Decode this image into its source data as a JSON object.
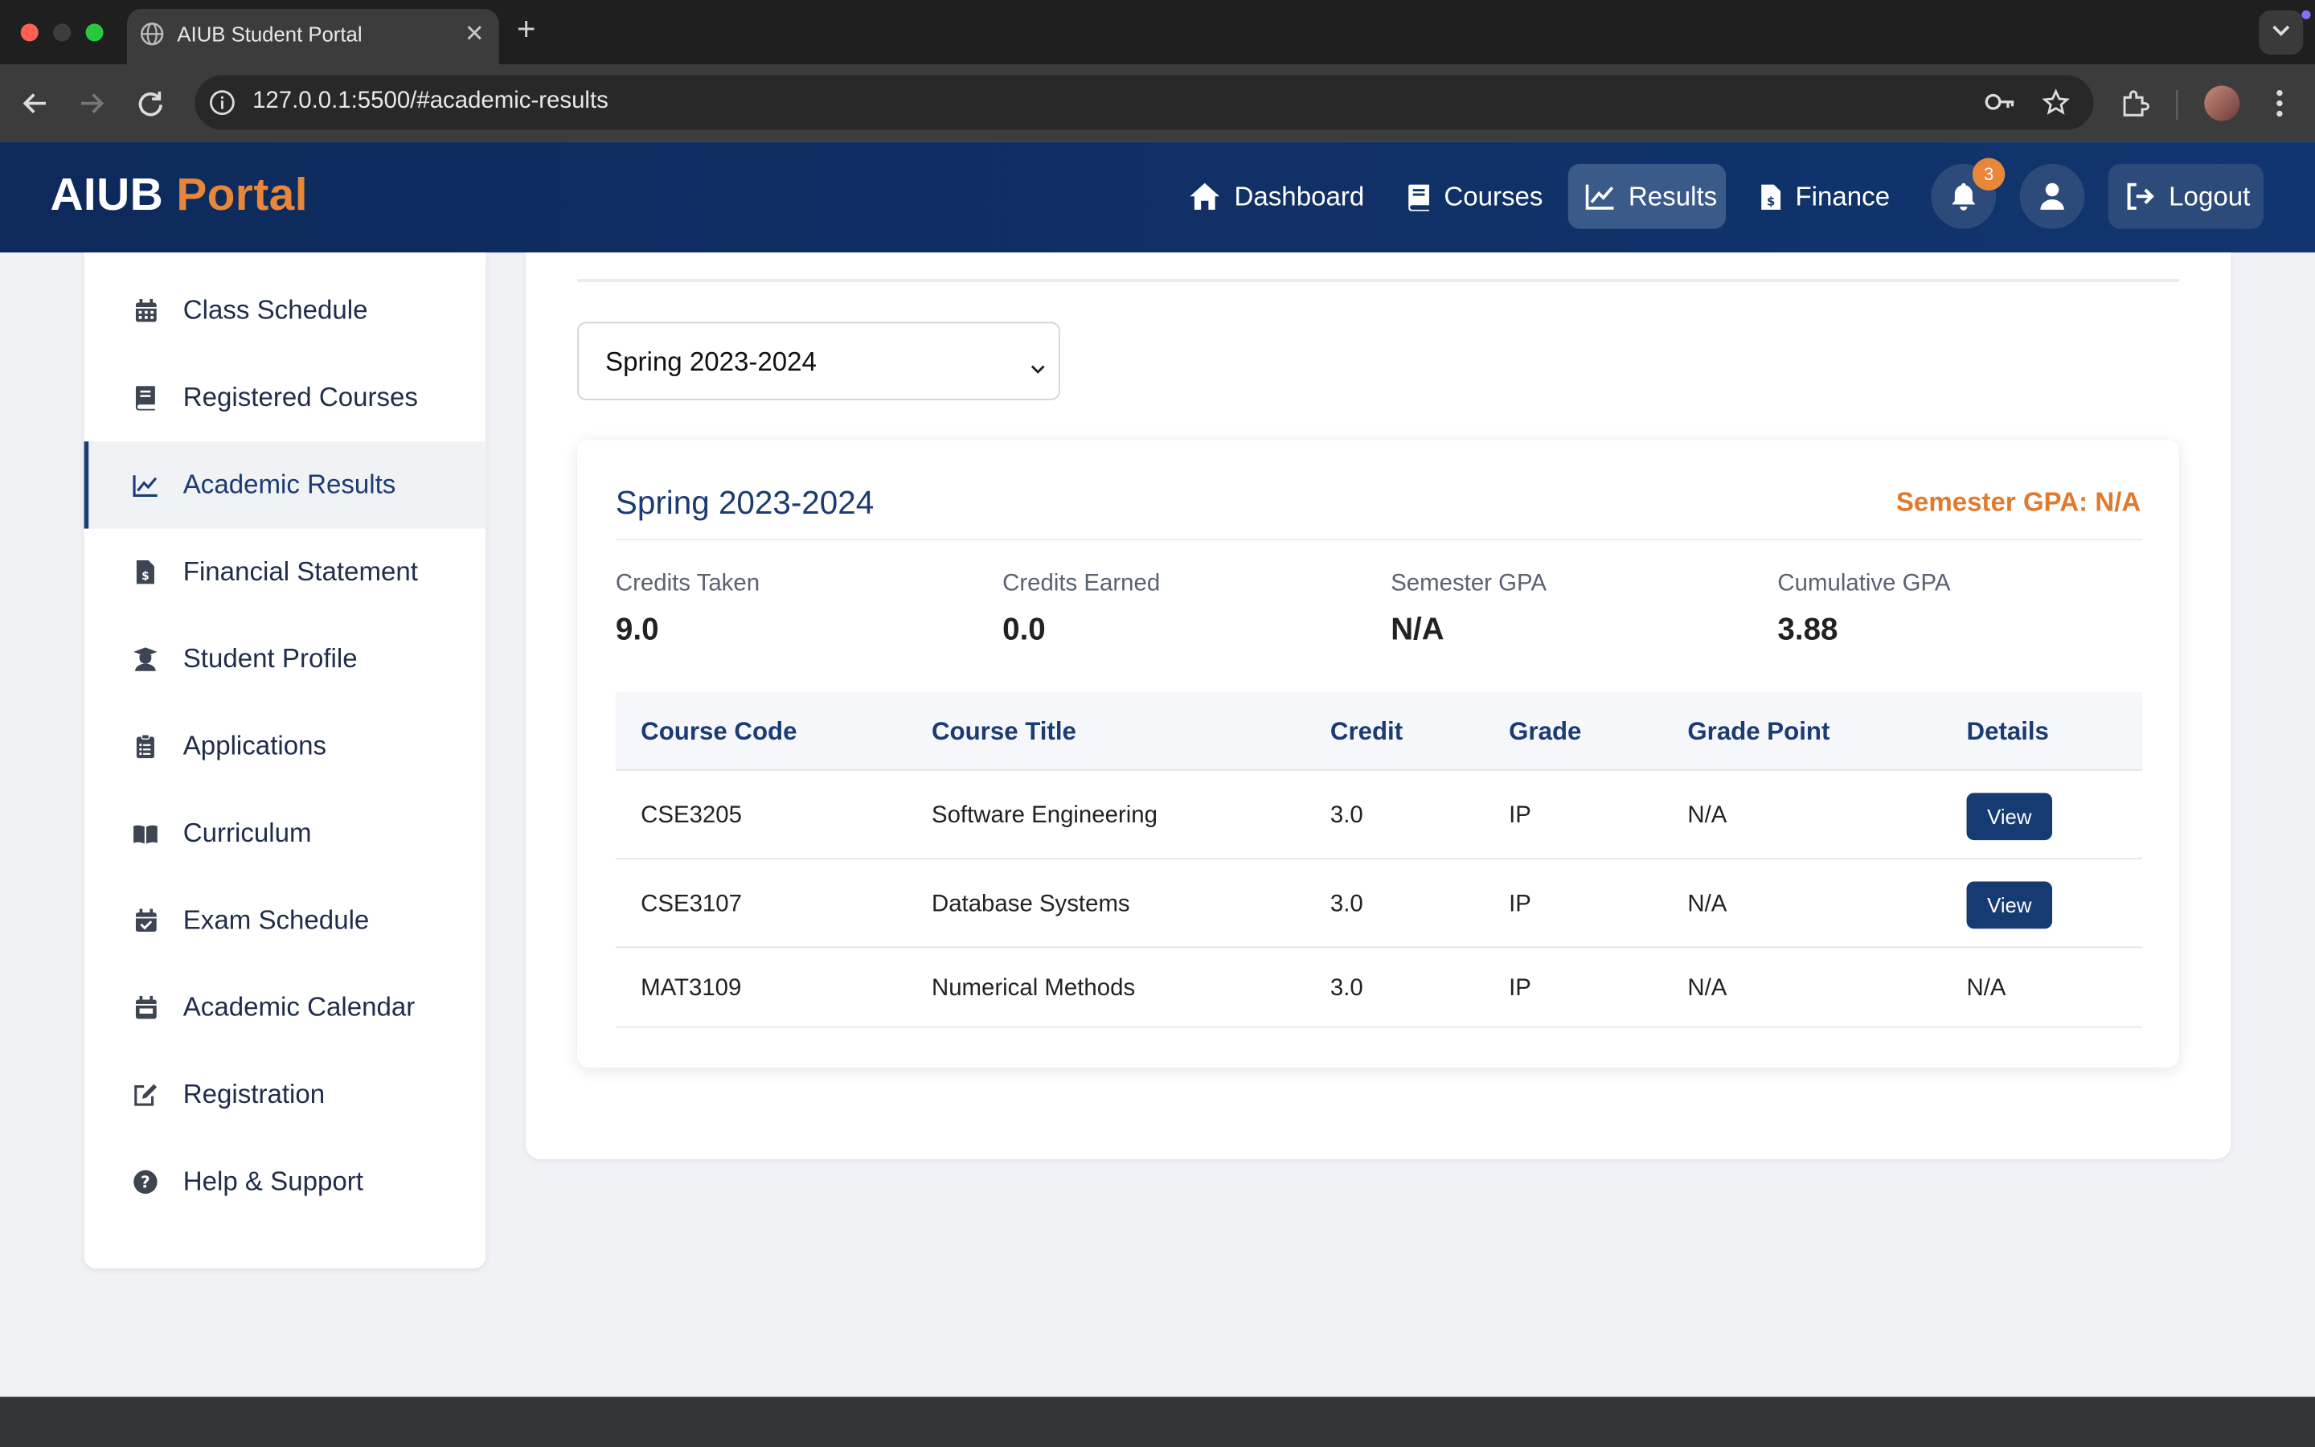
{
  "browser": {
    "tab_title": "AIUB Student Portal",
    "url": "127.0.0.1:5500/#academic-results"
  },
  "header": {
    "logo_main": "AIUB",
    "logo_accent": "Portal",
    "nav": [
      {
        "label": "Dashboard",
        "icon": "home-icon"
      },
      {
        "label": "Courses",
        "icon": "book-icon"
      },
      {
        "label": "Results",
        "icon": "chart-line-icon",
        "active": true
      },
      {
        "label": "Finance",
        "icon": "invoice-icon"
      }
    ],
    "notification_count": "3",
    "logout_label": "Logout"
  },
  "sidebar": {
    "items": [
      {
        "label": "Class Schedule",
        "icon": "calendar-icon"
      },
      {
        "label": "Registered Courses",
        "icon": "book-icon"
      },
      {
        "label": "Academic Results",
        "icon": "chart-line-icon",
        "active": true
      },
      {
        "label": "Financial Statement",
        "icon": "invoice-dollar-icon"
      },
      {
        "label": "Student Profile",
        "icon": "graduate-icon"
      },
      {
        "label": "Applications",
        "icon": "clipboard-icon"
      },
      {
        "label": "Curriculum",
        "icon": "open-book-icon"
      },
      {
        "label": "Exam Schedule",
        "icon": "calendar-check-icon"
      },
      {
        "label": "Academic Calendar",
        "icon": "calendar-day-icon"
      },
      {
        "label": "Registration",
        "icon": "edit-icon"
      },
      {
        "label": "Help & Support",
        "icon": "question-circle-icon"
      }
    ]
  },
  "main": {
    "semester_select": "Spring 2023-2024",
    "card": {
      "title": "Spring 2023-2024",
      "gpa_badge": "Semester GPA: N/A",
      "stats": [
        {
          "label": "Credits Taken",
          "value": "9.0"
        },
        {
          "label": "Credits Earned",
          "value": "0.0"
        },
        {
          "label": "Semester GPA",
          "value": "N/A"
        },
        {
          "label": "Cumulative GPA",
          "value": "3.88"
        }
      ],
      "columns": [
        "Course Code",
        "Course Title",
        "Credit",
        "Grade",
        "Grade Point",
        "Details"
      ],
      "rows": [
        {
          "code": "CSE3205",
          "title": "Software Engineering",
          "credit": "3.0",
          "grade": "IP",
          "grade_point": "N/A",
          "details": "View"
        },
        {
          "code": "CSE3107",
          "title": "Database Systems",
          "credit": "3.0",
          "grade": "IP",
          "grade_point": "N/A",
          "details": "View"
        },
        {
          "code": "MAT3109",
          "title": "Numerical Methods",
          "credit": "3.0",
          "grade": "IP",
          "grade_point": "N/A",
          "details": "N/A"
        }
      ]
    }
  },
  "colors": {
    "brand_navy": "#0e2a5c",
    "accent_orange": "#e8873a",
    "table_header_text": "#1a3b73"
  }
}
